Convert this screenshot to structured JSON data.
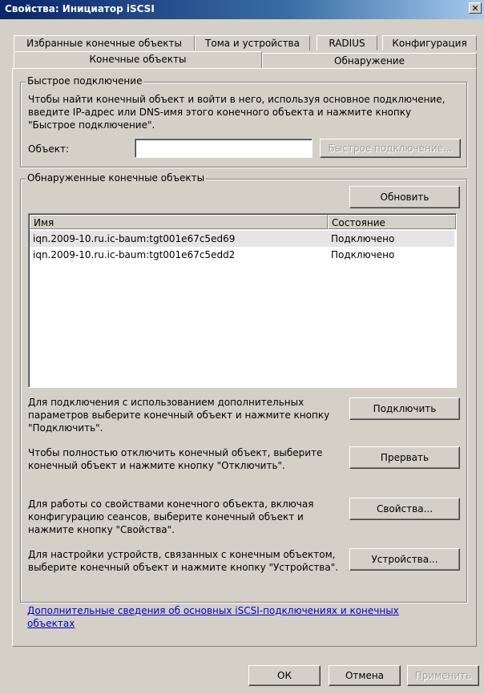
{
  "window": {
    "title": "Свойства: Инициатор iSCSI",
    "close_label": "✕"
  },
  "tabs": {
    "back_row": [
      "Избранные конечные объекты",
      "Тома и устройства",
      "RADIUS",
      "Конфигурация"
    ],
    "front_row": [
      "Конечные объекты",
      "Обнаружение"
    ],
    "active": "Конечные объекты"
  },
  "quick_connect": {
    "legend": "Быстрое подключение",
    "description": "Чтобы найти конечный объект и войти в него, используя основное подключение, введите IP-адрес или DNS-имя этого конечного объекта и нажмите кнопку \"Быстрое подключение\".",
    "target_label": "Объект:",
    "target_value": "",
    "button_label": "Быстрое подключение..."
  },
  "discovered": {
    "legend": "Обнаруженные конечные объекты",
    "refresh_label": "Обновить",
    "columns": [
      "Имя",
      "Состояние"
    ],
    "rows": [
      {
        "name": "iqn.2009-10.ru.ic-baum:tgt001e67c5ed69",
        "status": "Подключено"
      },
      {
        "name": "iqn.2009-10.ru.ic-baum:tgt001e67c5edd2",
        "status": "Подключено"
      }
    ]
  },
  "actions": [
    {
      "text": "Для подключения с использованием дополнительных параметров выберите конечный объект и нажмите кнопку \"Подключить\".",
      "button": "Подключить"
    },
    {
      "text": "Чтобы полностью отключить конечный объект, выберите конечный объект и нажмите кнопку \"Отключить\".",
      "button": "Прервать"
    },
    {
      "text": "Для работы со свойствами конечного объекта, включая конфигурацию сеансов, выберите конечный объект и нажмите кнопку \"Свойства\".",
      "button": "Свойства..."
    },
    {
      "text": "Для настройки устройств, связанных с конечным объектом, выберите конечный объект и нажмите кнопку \"Устройства\".",
      "button": "Устройства..."
    }
  ],
  "help_link": "Дополнительные сведения об основных iSCSI-подключениях и конечных объектах",
  "footer": {
    "ok": "ОК",
    "cancel": "Отмена",
    "apply": "Применить"
  }
}
